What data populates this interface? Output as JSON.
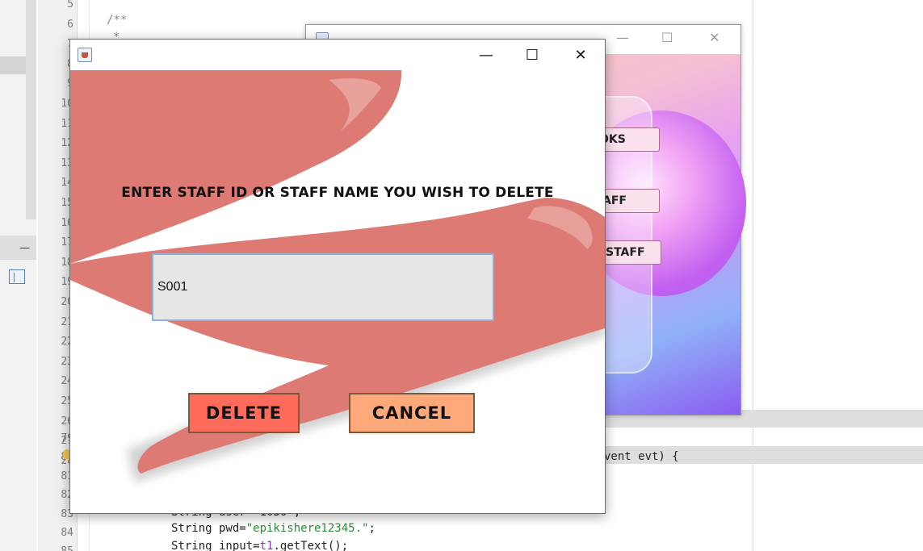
{
  "ide": {
    "line_numbers": [
      "5",
      "6",
      "7",
      "8",
      "9",
      "10",
      "11",
      "12",
      "13",
      "14",
      "15",
      "16",
      "17",
      "18",
      "19",
      "20",
      "21",
      "22",
      "23",
      "24",
      "25",
      "26",
      "27",
      "28",
      "79",
      "80",
      "81",
      "82",
      "83",
      "84",
      "85"
    ],
    "comment_open": "/**",
    "comment_star": "*",
    "code_event": "vent evt) {",
    "code_line_83": "String user=\"1030\";",
    "code_line_84_pre": "String pwd=",
    "code_line_84_str": "\"epikishere12345.\"",
    "code_line_84_post": ";",
    "code_line_85_pre": "String input=",
    "code_line_85_fld": "t1",
    "code_line_85_post": ".getText();",
    "panel_minimize": "—",
    "trailing_text": "n."
  },
  "back_window": {
    "buttons": [
      "OKS",
      "AFF",
      "STAFF"
    ],
    "controls": {
      "minimize": "—",
      "maximize": "☐",
      "close": "✕"
    }
  },
  "dialog": {
    "controls": {
      "minimize": "—",
      "maximize": "☐",
      "close": "✕"
    },
    "prompt": "ENTER STAFF ID OR STAFF NAME YOU WISH TO DELETE",
    "input_value": "S001",
    "delete_label": "DELETE",
    "cancel_label": "CANCEL"
  },
  "colors": {
    "brush": "#dc7a73",
    "delete_bg": "#ff6b5b",
    "cancel_bg": "#ffa97a",
    "input_bg": "#e6e6e6",
    "input_border": "#8fb1d6"
  }
}
